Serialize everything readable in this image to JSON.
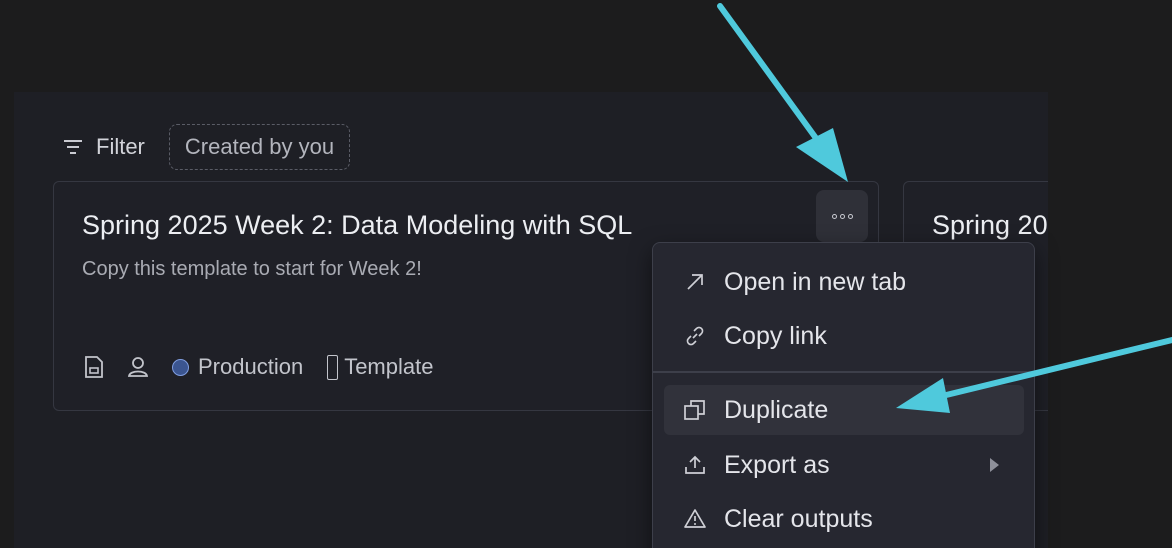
{
  "filter": {
    "label": "Filter",
    "chip": "Created by you"
  },
  "cards": [
    {
      "title": "Spring 2025 Week 2: Data Modeling with SQL",
      "description": "Copy this template to start for Week 2!",
      "status": "Production",
      "tag": "Template"
    },
    {
      "title": "Spring 20",
      "description": "te"
    }
  ],
  "menu": {
    "items": [
      {
        "label": "Open in new tab",
        "icon": "arrow-up-right-icon"
      },
      {
        "label": "Copy link",
        "icon": "link-icon"
      },
      {
        "label": "Duplicate",
        "icon": "duplicate-icon"
      },
      {
        "label": "Export as",
        "icon": "upload-icon",
        "submenu": true
      },
      {
        "label": "Clear outputs",
        "icon": "warning-icon"
      }
    ]
  },
  "colors": {
    "annotation_arrow": "#4fc9dc",
    "status_dot": "#3b5590"
  }
}
